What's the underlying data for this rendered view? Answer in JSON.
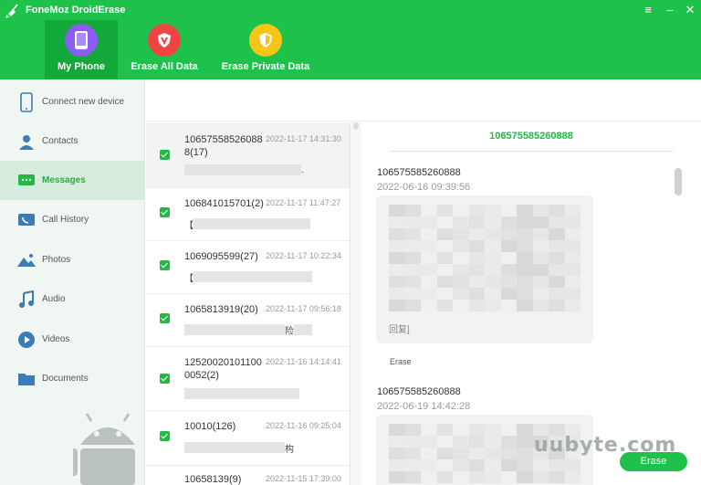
{
  "app": {
    "title": "FoneMoz DroidErase"
  },
  "window_controls": {
    "menu": "≡",
    "minimize": "–",
    "close": "✕"
  },
  "nav_tabs": [
    {
      "label": "My Phone",
      "color": "#8b5cf6"
    },
    {
      "label": "Erase All Data",
      "color": "#ef4444"
    },
    {
      "label": "Erase Private Data",
      "color": "#f5c518"
    }
  ],
  "sidebar": {
    "items": [
      {
        "label": "Connect new device",
        "icon": "phone-icon"
      },
      {
        "label": "Contacts",
        "icon": "contacts-icon"
      },
      {
        "label": "Messages",
        "icon": "messages-icon"
      },
      {
        "label": "Call History",
        "icon": "call-history-icon"
      },
      {
        "label": "Photos",
        "icon": "photos-icon"
      },
      {
        "label": "Audio",
        "icon": "audio-icon"
      },
      {
        "label": "Videos",
        "icon": "videos-icon"
      },
      {
        "label": "Documents",
        "icon": "documents-icon"
      }
    ]
  },
  "messages": [
    {
      "sender": "106575585260888(17)",
      "time": "2022-11-17 14:31:30",
      "preview": "."
    },
    {
      "sender": "106841015701(2)",
      "time": "2022-11-17 11:47:27",
      "preview": "【"
    },
    {
      "sender": "1069095599(27)",
      "time": "2022-11-17 10:22:34",
      "preview": "【"
    },
    {
      "sender": "1065813919(20)",
      "time": "2022-11-17 09:56:18",
      "preview": "险"
    },
    {
      "sender": "125200201011000052(2)",
      "time": "2022-11-16 14:14:41",
      "preview": ""
    },
    {
      "sender": "10010(126)",
      "time": "2022-11-16 09:25:04",
      "preview": "构"
    },
    {
      "sender": "10658139(9)",
      "time": "2022-11-15 17:39:00",
      "preview": ""
    }
  ],
  "detail": {
    "title": "106575585260888",
    "conversation": [
      {
        "sender": "106575585260888",
        "date": "2022-06-16 09:39:56",
        "reply": "回复]",
        "action": "Erase"
      },
      {
        "sender": "106575585260888",
        "date": "2022-06-19 14:42:28"
      }
    ]
  },
  "watermark": "uubyte.com",
  "footer": {
    "erase_button": "Erase"
  },
  "colors": {
    "brand_green": "#1ec24b",
    "active_tab": "#13a83a",
    "accent_text": "#1fb944"
  }
}
